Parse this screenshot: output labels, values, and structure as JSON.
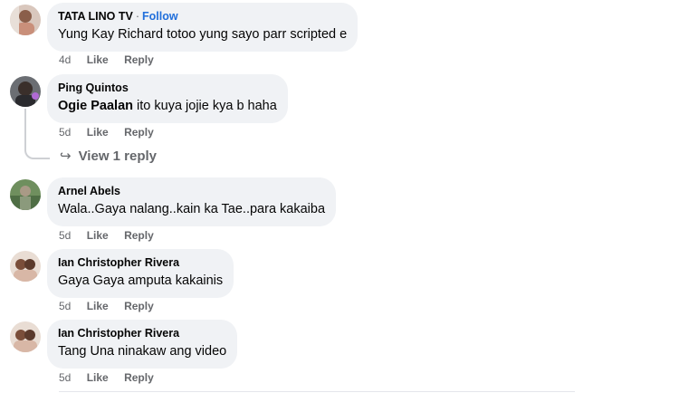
{
  "comments": [
    {
      "author": "TATA LINO TV",
      "dot": "·",
      "follow": "Follow",
      "tag": "",
      "text": "Yung Kay Richard totoo yung sayo parr scripted e",
      "time": "4d",
      "like": "Like",
      "reply": "Reply"
    },
    {
      "author": "Ping Quintos",
      "tag": "Ogie Paalan",
      "text": " ito kuya jojie kya b haha",
      "time": "5d",
      "like": "Like",
      "reply": "Reply",
      "view_replies": "View 1 reply"
    },
    {
      "author": "Arnel Abels",
      "text": "Wala..Gaya nalang..kain ka Tae..para kakaiba",
      "time": "5d",
      "like": "Like",
      "reply": "Reply"
    },
    {
      "author": "Ian Christopher Rivera",
      "text": "Gaya Gaya amputa kakainis",
      "time": "5d",
      "like": "Like",
      "reply": "Reply"
    },
    {
      "author": "Ian Christopher Rivera",
      "text": "Tang Una ninakaw ang video",
      "time": "5d",
      "like": "Like",
      "reply": "Reply"
    }
  ],
  "icons": {
    "reply_arrow": "↪"
  },
  "colors": {
    "bubble_bg": "#f0f2f5",
    "follow_link": "#216fdb",
    "meta_text": "#65676b"
  }
}
